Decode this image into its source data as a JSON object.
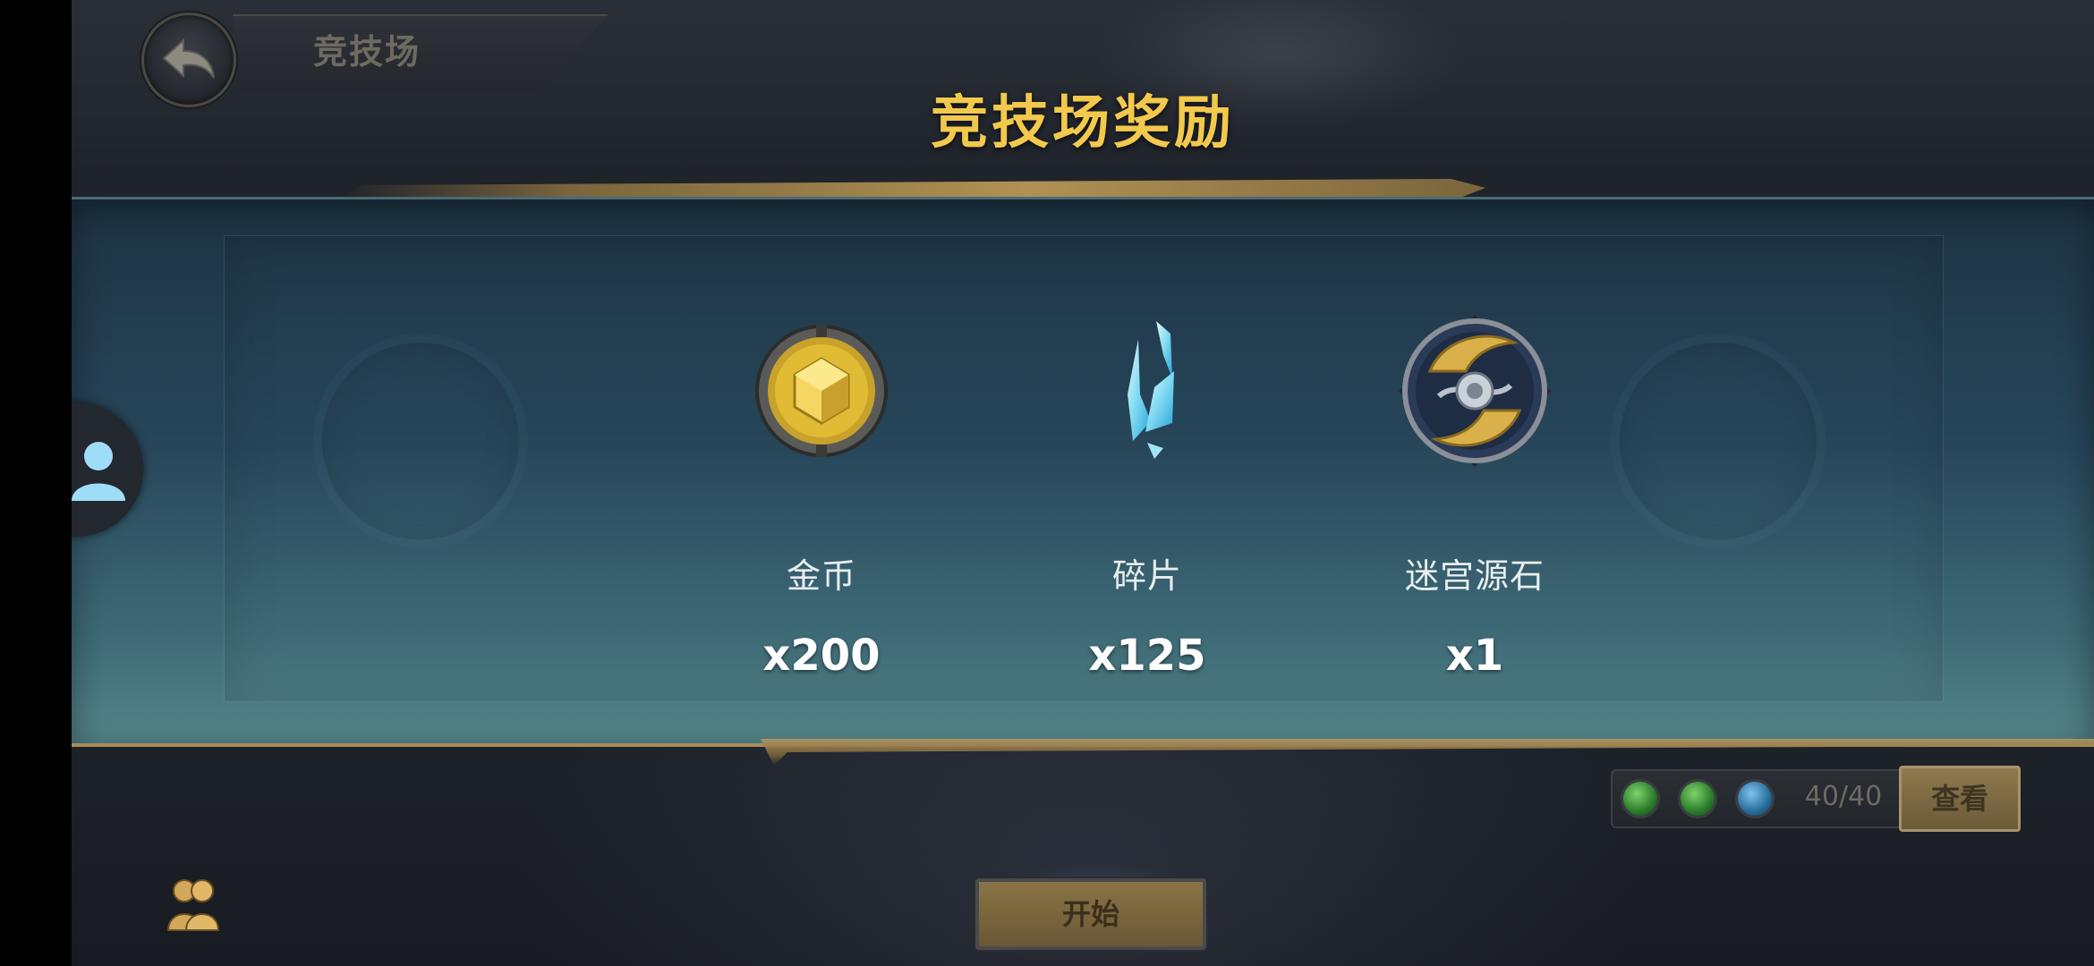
{
  "header": {
    "back_label": "竞技场",
    "title": "竞技场奖励"
  },
  "rewards": [
    {
      "name": "金币",
      "count": "x200",
      "icon": "gold-coin-icon"
    },
    {
      "name": "碎片",
      "count": "x125",
      "icon": "crystal-shard-icon"
    },
    {
      "name": "迷宫源石",
      "count": "x1",
      "icon": "labyrinth-stone-icon"
    }
  ],
  "footer": {
    "stamina": "40/40",
    "view_label": "查看",
    "start_label": "开始",
    "orbs": [
      "green",
      "green",
      "blue"
    ]
  },
  "colors": {
    "title_gold": "#f2c94c",
    "panel_teal": "#3e6a76"
  }
}
